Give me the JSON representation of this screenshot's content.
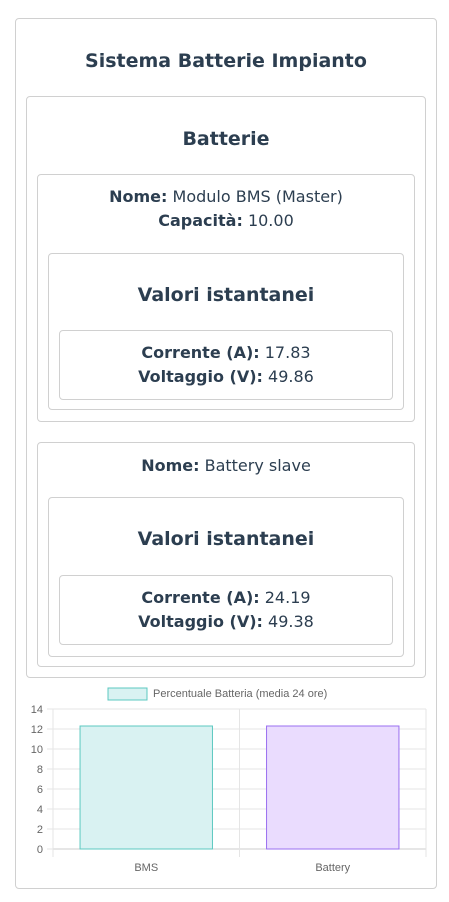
{
  "page": {
    "title": "Sistema Batterie Impianto"
  },
  "batteries_section": {
    "title": "Batterie",
    "batteries": [
      {
        "name_label": "Nome:",
        "name": "Modulo BMS (Master)",
        "capacity_label": "Capacità:",
        "capacity": "10.00",
        "instant_title": "Valori istantanei",
        "current_label": "Corrente (A):",
        "current": "17.83",
        "voltage_label": "Voltaggio (V):",
        "voltage": "49.86"
      },
      {
        "name_label": "Nome:",
        "name": "Battery slave",
        "instant_title": "Valori istantanei",
        "current_label": "Corrente (A):",
        "current": "24.19",
        "voltage_label": "Voltaggio (V):",
        "voltage": "49.38"
      }
    ]
  },
  "chart_data": {
    "type": "bar",
    "categories": [
      "BMS",
      "Battery"
    ],
    "series": [
      {
        "name": "Percentuale Batteria (media 24 ore)",
        "values": [
          12.3,
          12.3
        ]
      }
    ],
    "bar_colors": [
      {
        "fill": "#d9f2f2",
        "stroke": "#5cc8c0"
      },
      {
        "fill": "#eadcfe",
        "stroke": "#9a6ff0"
      }
    ],
    "legend_color": {
      "fill": "#d9f2f2",
      "stroke": "#5cc8c0"
    },
    "ylim": [
      0,
      14
    ],
    "yticks": [
      "0",
      "2",
      "4",
      "6",
      "8",
      "10",
      "12",
      "14"
    ],
    "grid": true,
    "legend_position": "top"
  }
}
